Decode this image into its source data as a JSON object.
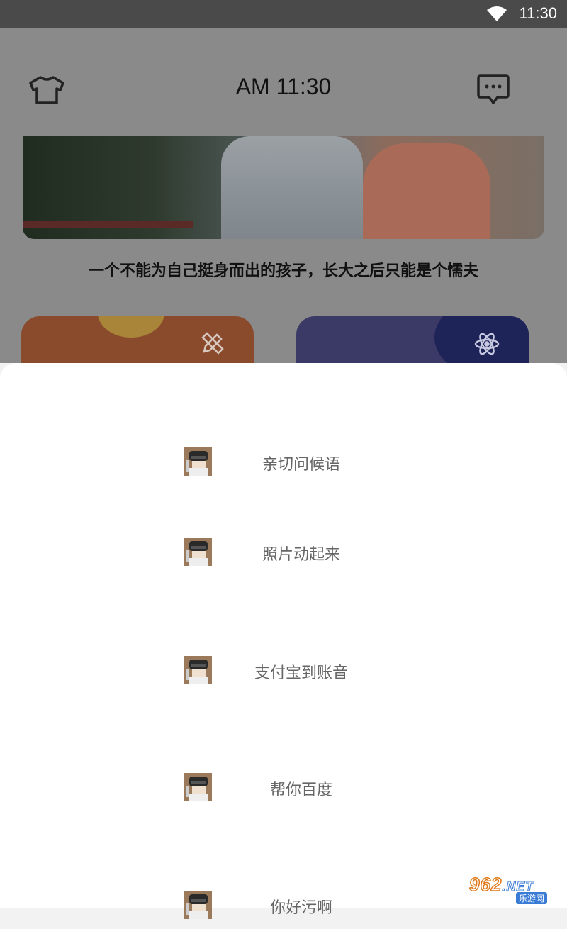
{
  "status_bar": {
    "time": "11:30"
  },
  "app_bar": {
    "title": "AM 11:30"
  },
  "content": {
    "quote": "一个不能为自己挺身而出的孩子，长大之后只能是个懦夫"
  },
  "bottom_sheet": {
    "items": [
      {
        "label": "亲切问候语"
      },
      {
        "label": "照片动起来"
      },
      {
        "label": "支付宝到账音"
      },
      {
        "label": "帮你百度"
      },
      {
        "label": "你好污啊"
      }
    ]
  },
  "watermark": {
    "brand": "962",
    "suffix": ".NET",
    "sub": "乐游网"
  },
  "colors": {
    "card_orange": "#8a4a2c",
    "card_blue": "#3b3a66",
    "scrim_appbar": "#8a8a8a",
    "menu_text": "#666666"
  }
}
